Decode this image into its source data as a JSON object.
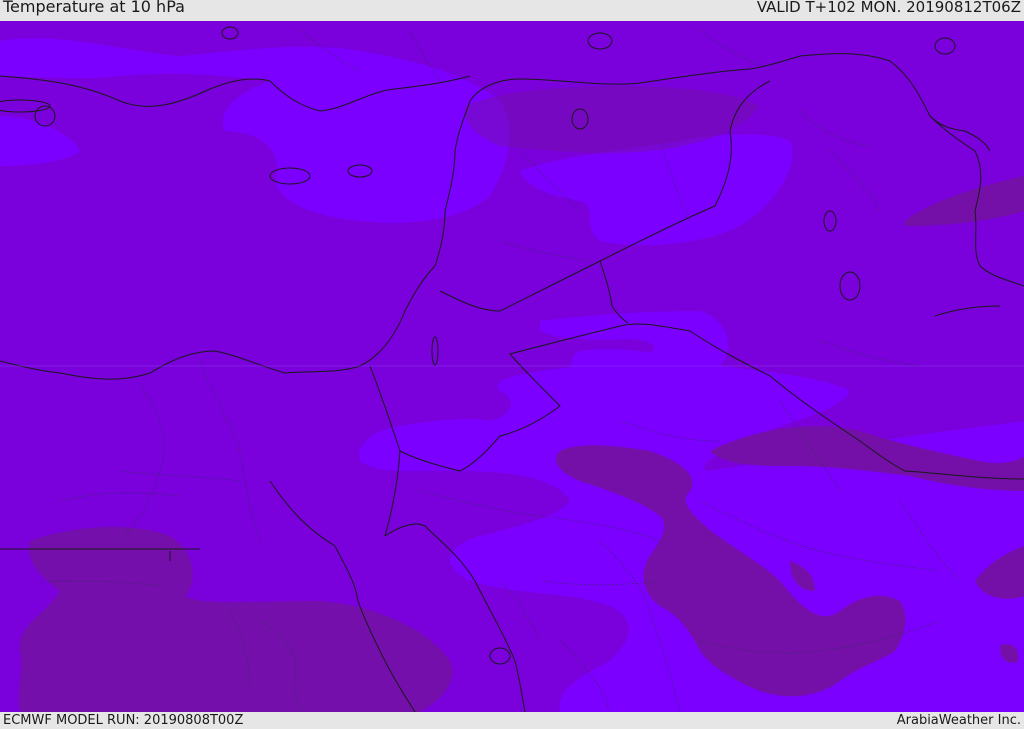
{
  "header": {
    "title": "Temperature at 10 hPa",
    "valid_time": "VALID T+102 MON. 20190812T06Z"
  },
  "footer": {
    "model_run": "ECMWF MODEL RUN: 20190808T00Z",
    "brand": "ArabiaWeather Inc."
  },
  "colors": {
    "base_fill": "#7a00dc",
    "lighter_band": "#7c00ff",
    "darker_band": "#7410a8",
    "border_line": "#1a1a1a",
    "frame": "#e6e6e6"
  }
}
